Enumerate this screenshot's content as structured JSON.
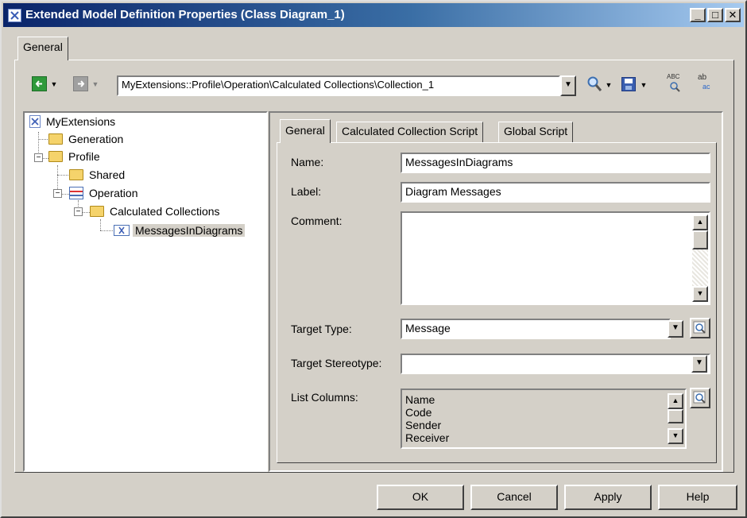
{
  "window": {
    "title": "Extended Model Definition Properties (Class Diagram_1)",
    "controls": {
      "minimize": "_",
      "maximize": "□",
      "close": "✕"
    }
  },
  "outer_tabs": [
    {
      "label": "General"
    }
  ],
  "toolbar": {
    "path_value": "MyExtensions::Profile\\Operation\\Calculated Collections\\Collection_1",
    "back_icon": "back-arrow-icon",
    "forward_icon": "forward-arrow-icon",
    "find_icon": "magnifier-icon",
    "save_icon": "floppy-disk-icon",
    "spellcheck_icon": "abc-spellcheck-icon",
    "replace_icon": "ab-replace-icon",
    "spell_label": "ABC",
    "replace_label_top": "ab",
    "replace_label_bottom": "ac"
  },
  "tree": {
    "items": [
      {
        "label": "MyExtensions"
      },
      {
        "label": "Generation"
      },
      {
        "label": "Profile"
      },
      {
        "label": "Shared"
      },
      {
        "label": "Operation"
      },
      {
        "label": "Calculated Collections"
      },
      {
        "label": "MessagesInDiagrams"
      }
    ]
  },
  "inner_tabs": [
    {
      "label": "General"
    },
    {
      "label": "Calculated Collection Script"
    },
    {
      "label": "Global Script"
    }
  ],
  "form": {
    "name_label": "Name:",
    "name_value": "MessagesInDiagrams",
    "label_label": "Label:",
    "label_value": "Diagram Messages",
    "comment_label": "Comment:",
    "comment_value": "",
    "target_type_label": "Target Type:",
    "target_type_value": "Message",
    "target_stereotype_label": "Target Stereotype:",
    "target_stereotype_value": "",
    "list_columns_label": "List Columns:",
    "list_columns_items": [
      "Name",
      "Code",
      "Sender",
      "Receiver"
    ]
  },
  "buttons": {
    "ok": "OK",
    "cancel": "Cancel",
    "apply": "Apply",
    "help": "Help"
  }
}
